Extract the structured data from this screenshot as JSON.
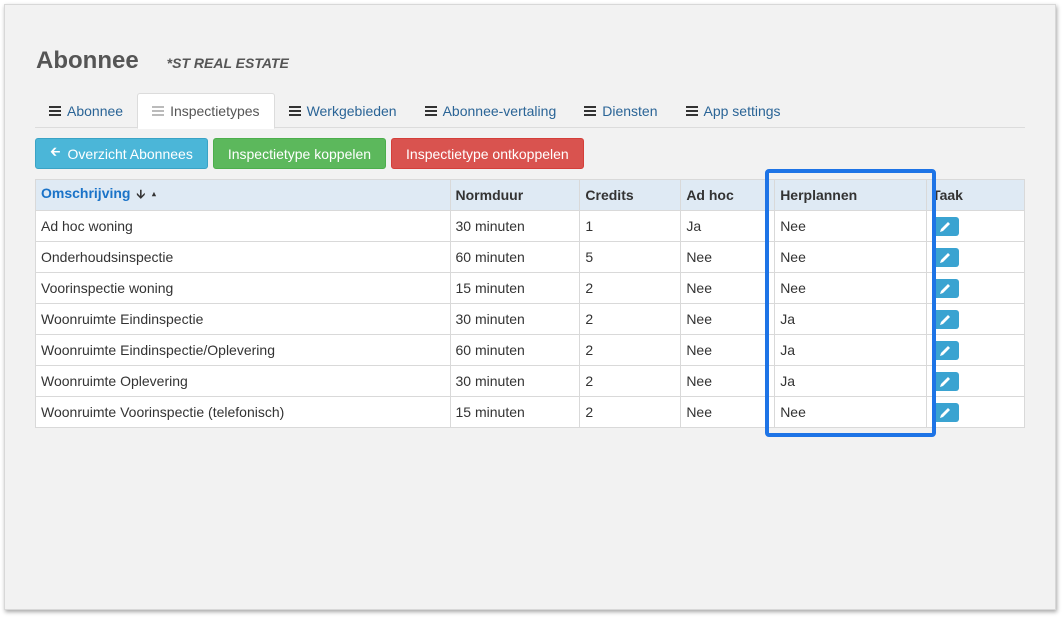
{
  "header": {
    "title": "Abonnee",
    "subtitle": "*ST REAL ESTATE"
  },
  "tabs": [
    {
      "label": "Abonnee",
      "icon": "list-icon",
      "active": false
    },
    {
      "label": "Inspectietypes",
      "icon": "list-icon",
      "active": true
    },
    {
      "label": "Werkgebieden",
      "icon": "list-icon",
      "active": false
    },
    {
      "label": "Abonnee-vertaling",
      "icon": "list-icon",
      "active": false
    },
    {
      "label": "Diensten",
      "icon": "list-icon",
      "active": false
    },
    {
      "label": "App settings",
      "icon": "list-icon",
      "active": false
    }
  ],
  "buttons": {
    "overview": "Overzicht Abonnees",
    "link": "Inspectietype koppelen",
    "unlink": "Inspectietype ontkoppelen"
  },
  "table": {
    "columns": [
      "Omschrijving",
      "Normduur",
      "Credits",
      "Ad hoc",
      "Herplannen",
      "Taak"
    ],
    "rows": [
      {
        "omschrijving": "Ad hoc woning",
        "normduur": "30 minuten",
        "credits": "1",
        "adhoc": "Ja",
        "herplannen": "Nee"
      },
      {
        "omschrijving": "Onderhoudsinspectie",
        "normduur": "60 minuten",
        "credits": "5",
        "adhoc": "Nee",
        "herplannen": "Nee"
      },
      {
        "omschrijving": "Voorinspectie woning",
        "normduur": "15 minuten",
        "credits": "2",
        "adhoc": "Nee",
        "herplannen": "Nee"
      },
      {
        "omschrijving": "Woonruimte Eindinspectie",
        "normduur": "30 minuten",
        "credits": "2",
        "adhoc": "Nee",
        "herplannen": "Ja"
      },
      {
        "omschrijving": "Woonruimte Eindinspectie/Oplevering",
        "normduur": "60 minuten",
        "credits": "2",
        "adhoc": "Nee",
        "herplannen": "Ja"
      },
      {
        "omschrijving": "Woonruimte Oplevering",
        "normduur": "30 minuten",
        "credits": "2",
        "adhoc": "Nee",
        "herplannen": "Ja"
      },
      {
        "omschrijving": "Woonruimte Voorinspectie (telefonisch)",
        "normduur": "15 minuten",
        "credits": "2",
        "adhoc": "Nee",
        "herplannen": "Nee"
      }
    ]
  },
  "colors": {
    "info": "#4bb6d8",
    "success": "#5cb85c",
    "danger": "#d9534f",
    "highlight": "#1e74e6",
    "header_bg": "#dfeaf4"
  }
}
